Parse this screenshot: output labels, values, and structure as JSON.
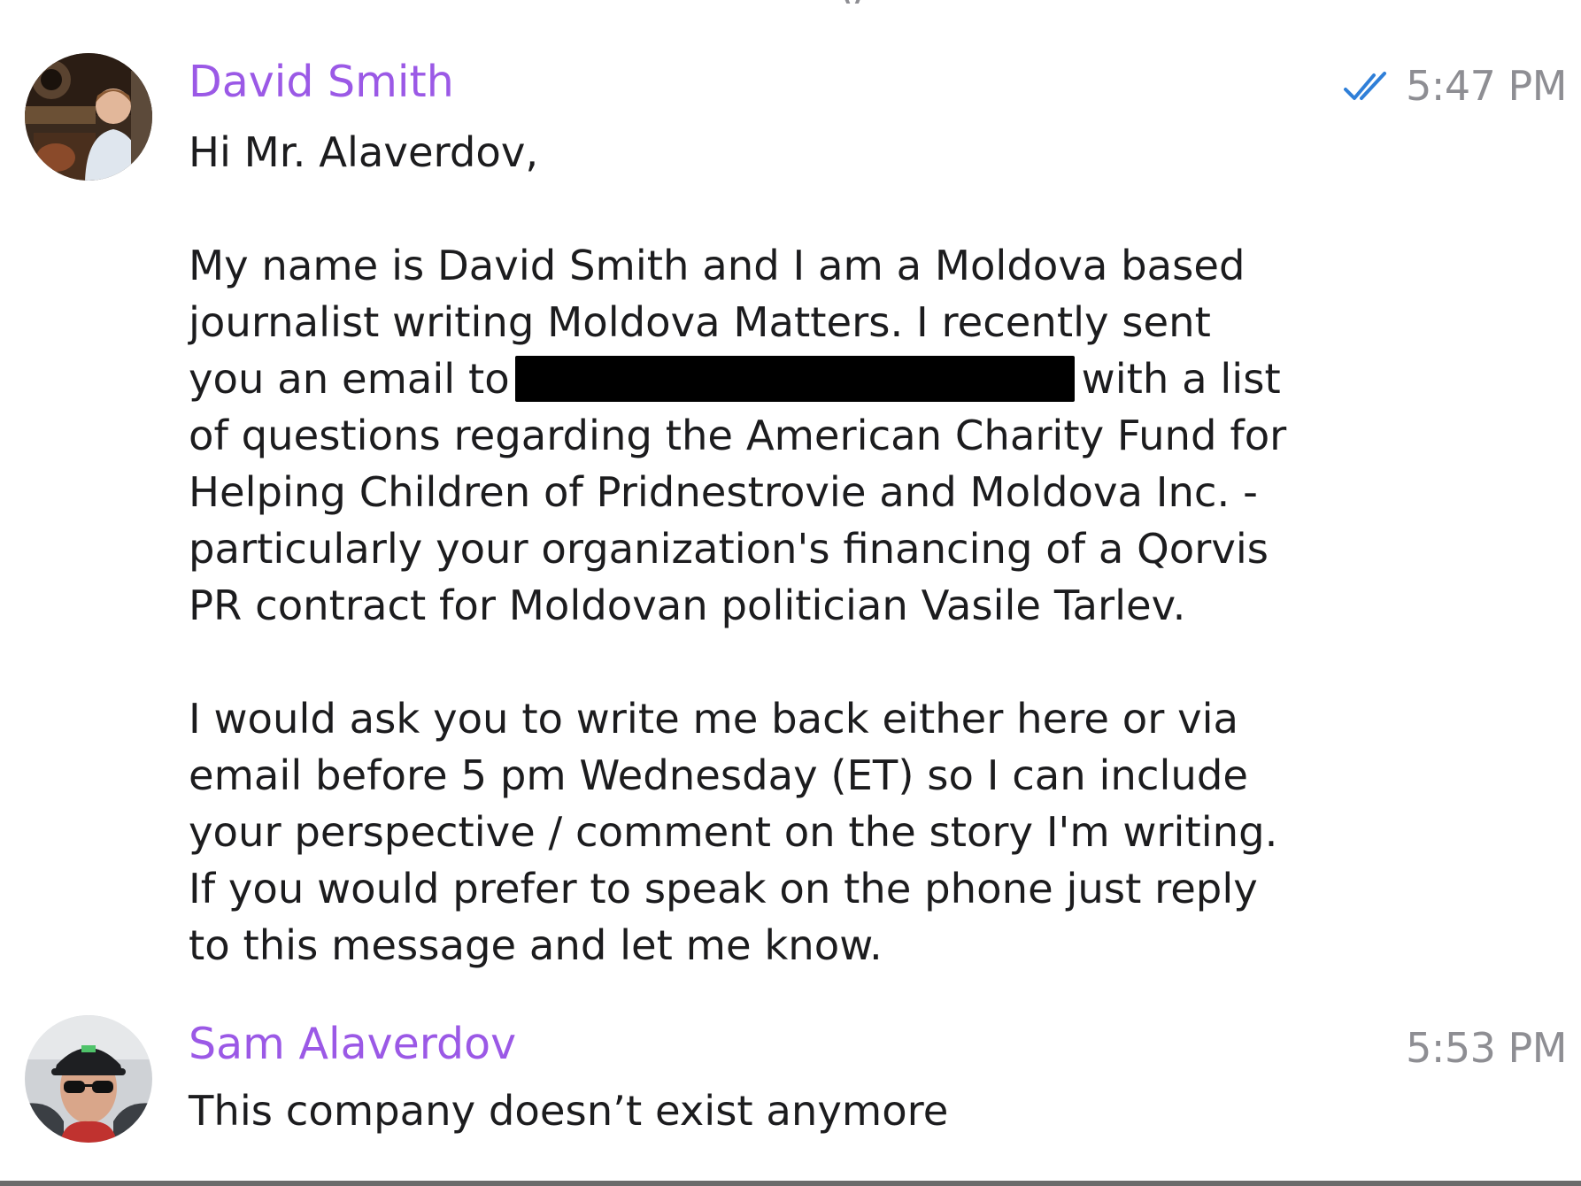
{
  "messages": [
    {
      "sender": "David Smith",
      "time": "5:47 PM",
      "read_status": "double-check-read",
      "greeting": "Hi Mr. Alaverdov,",
      "paragraph_1": [
        "My name is David Smith and I am a Moldova based",
        "journalist writing Moldova Matters. I recently sent",
        "you an email to",
        "with a list",
        "of questions regarding the American Charity Fund for",
        "Helping Children of Pridnestrovie and Moldova Inc. -",
        "particularly your organization's financing of a Qorvis",
        "PR contract for Moldovan politician Vasile Tarlev."
      ],
      "paragraph_2": [
        "I would ask you to write me back either here or via",
        "email before 5 pm Wednesday (ET) so I can include",
        "your perspective / comment on the story I'm writing.",
        "If you would prefer to speak on the phone just reply",
        "to this message and let me know."
      ]
    },
    {
      "sender": "Sam Alaverdov",
      "time": "5:53 PM",
      "text": "This company doesn’t exist anymore"
    }
  ],
  "colors": {
    "sender_name": "#9b59e6",
    "timestamp": "#8e8e93",
    "read_check": "#2f7fd8",
    "body_text": "#1c1c1e",
    "redaction": "#000000"
  },
  "icons": {
    "read_receipt": "double-check-icon"
  }
}
